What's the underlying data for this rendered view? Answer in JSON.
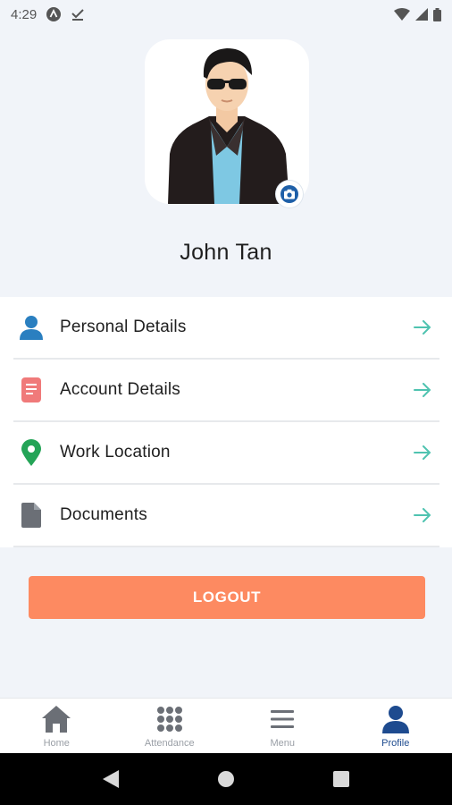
{
  "status_bar": {
    "time": "4:29"
  },
  "profile": {
    "name": "John Tan"
  },
  "menu": {
    "items": [
      {
        "label": "Personal Details",
        "icon": "person-icon",
        "color": "#2a7fc0"
      },
      {
        "label": "Account Details",
        "icon": "document-list-icon",
        "color": "#f07a7a"
      },
      {
        "label": "Work Location",
        "icon": "map-pin-icon",
        "color": "#24a457"
      },
      {
        "label": "Documents",
        "icon": "file-icon",
        "color": "#6b6f76"
      }
    ],
    "arrow_color": "#4fc3b0"
  },
  "logout": {
    "label": "LOGOUT",
    "color": "#fd8a61"
  },
  "bottom_nav": {
    "items": [
      {
        "label": "Home",
        "icon": "home-icon"
      },
      {
        "label": "Attendance",
        "icon": "grid-icon"
      },
      {
        "label": "Menu",
        "icon": "hamburger-icon"
      },
      {
        "label": "Profile",
        "icon": "person-icon",
        "active": true
      }
    ],
    "active_color": "#1e4b8f"
  }
}
